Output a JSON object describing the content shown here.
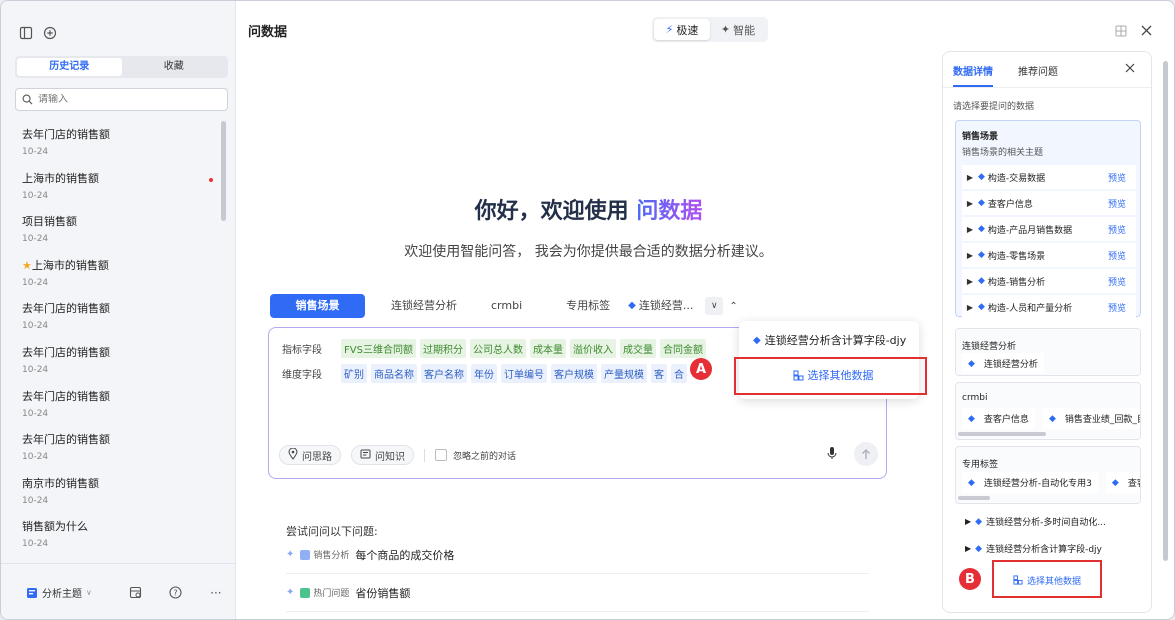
{
  "sidebar": {
    "seg_tabs": [
      "历史记录",
      "收藏"
    ],
    "search_placeholder": "请输入",
    "history": [
      {
        "title": "去年门店的销售额",
        "date": "10-24",
        "unread": false,
        "starred": false
      },
      {
        "title": "上海市的销售额",
        "date": "10-24",
        "unread": true,
        "starred": false
      },
      {
        "title": "项目销售额",
        "date": "10-24",
        "unread": false,
        "starred": false
      },
      {
        "title": "上海市的销售额",
        "date": "10-24",
        "unread": false,
        "starred": true
      },
      {
        "title": "去年门店的销售额",
        "date": "10-24",
        "unread": false,
        "starred": false
      },
      {
        "title": "去年门店的销售额",
        "date": "10-24",
        "unread": false,
        "starred": false
      },
      {
        "title": "去年门店的销售额",
        "date": "10-24",
        "unread": false,
        "starred": false
      },
      {
        "title": "去年门店的销售额",
        "date": "10-24",
        "unread": false,
        "starred": false
      },
      {
        "title": "南京市的销售额",
        "date": "10-24",
        "unread": false,
        "starred": false
      },
      {
        "title": "销售额为什么",
        "date": "10-24",
        "unread": false,
        "starred": false
      }
    ],
    "theme_label": "分析主题"
  },
  "main": {
    "title": "问数据",
    "modes": [
      "极速",
      "智能"
    ],
    "hero_prefix": "你好，欢迎使用",
    "hero_brand": "问数据",
    "subtitle": "欢迎使用智能问答， 我会为你提供最合适的数据分析建议。",
    "tabs": [
      "销售场景",
      "连锁经营分析",
      "crmbi",
      "专用标签",
      "连锁经营..."
    ],
    "metric_label": "指标字段",
    "metrics": [
      "FVS三维合同额",
      "过期积分",
      "公司总人数",
      "成本量",
      "溢价收入",
      "成交量",
      "合同金额"
    ],
    "dim_label": "维度字段",
    "dims": [
      "矿别",
      "商品名称",
      "客户名称",
      "年份",
      "订单编号",
      "客户规模",
      "产量规模",
      "客",
      "合"
    ],
    "tool_buttons": [
      "问思路",
      "问知识"
    ],
    "ignore_label": "忽略之前的对话",
    "dropdown": {
      "item": "连锁经营分析含计算字段-djy",
      "action": "选择其他数据"
    },
    "try_label": "尝试问问以下问题:",
    "suggestions": [
      {
        "tag": "销售分析",
        "text": "每个商品的成交价格"
      },
      {
        "tag": "热门问题",
        "text": "省份销售额"
      }
    ],
    "badge_a": "A",
    "badge_b": "B"
  },
  "panel": {
    "tabs": [
      "数据详情",
      "推荐问题"
    ],
    "hint": "请选择要提问的数据",
    "group1": {
      "title": "销售场景",
      "subtitle": "销售场景的相关主题",
      "items": [
        "构造-交易数据",
        "查客户信息",
        "构造-产品月销售数据",
        "构造-零售场景",
        "构造-销售分析",
        "构造-人员和产量分析"
      ],
      "preview": "预览"
    },
    "group2": {
      "title": "连锁经营分析",
      "items": [
        "连锁经营分析"
      ]
    },
    "group3": {
      "title": "crmbi",
      "items": [
        "查客户信息",
        "销售查业绩_回款_目"
      ]
    },
    "group4": {
      "title": "专用标签",
      "items": [
        "连锁经营分析-自动化专用3",
        "查客"
      ]
    },
    "loose": [
      "连锁经营分析-多时间自动化...",
      "连锁经营分析含计算字段-djy"
    ],
    "action": "选择其他数据"
  },
  "colors": {
    "accent": "#2f6bf5",
    "highlight": "#e03030",
    "badge": "#e62e36"
  }
}
